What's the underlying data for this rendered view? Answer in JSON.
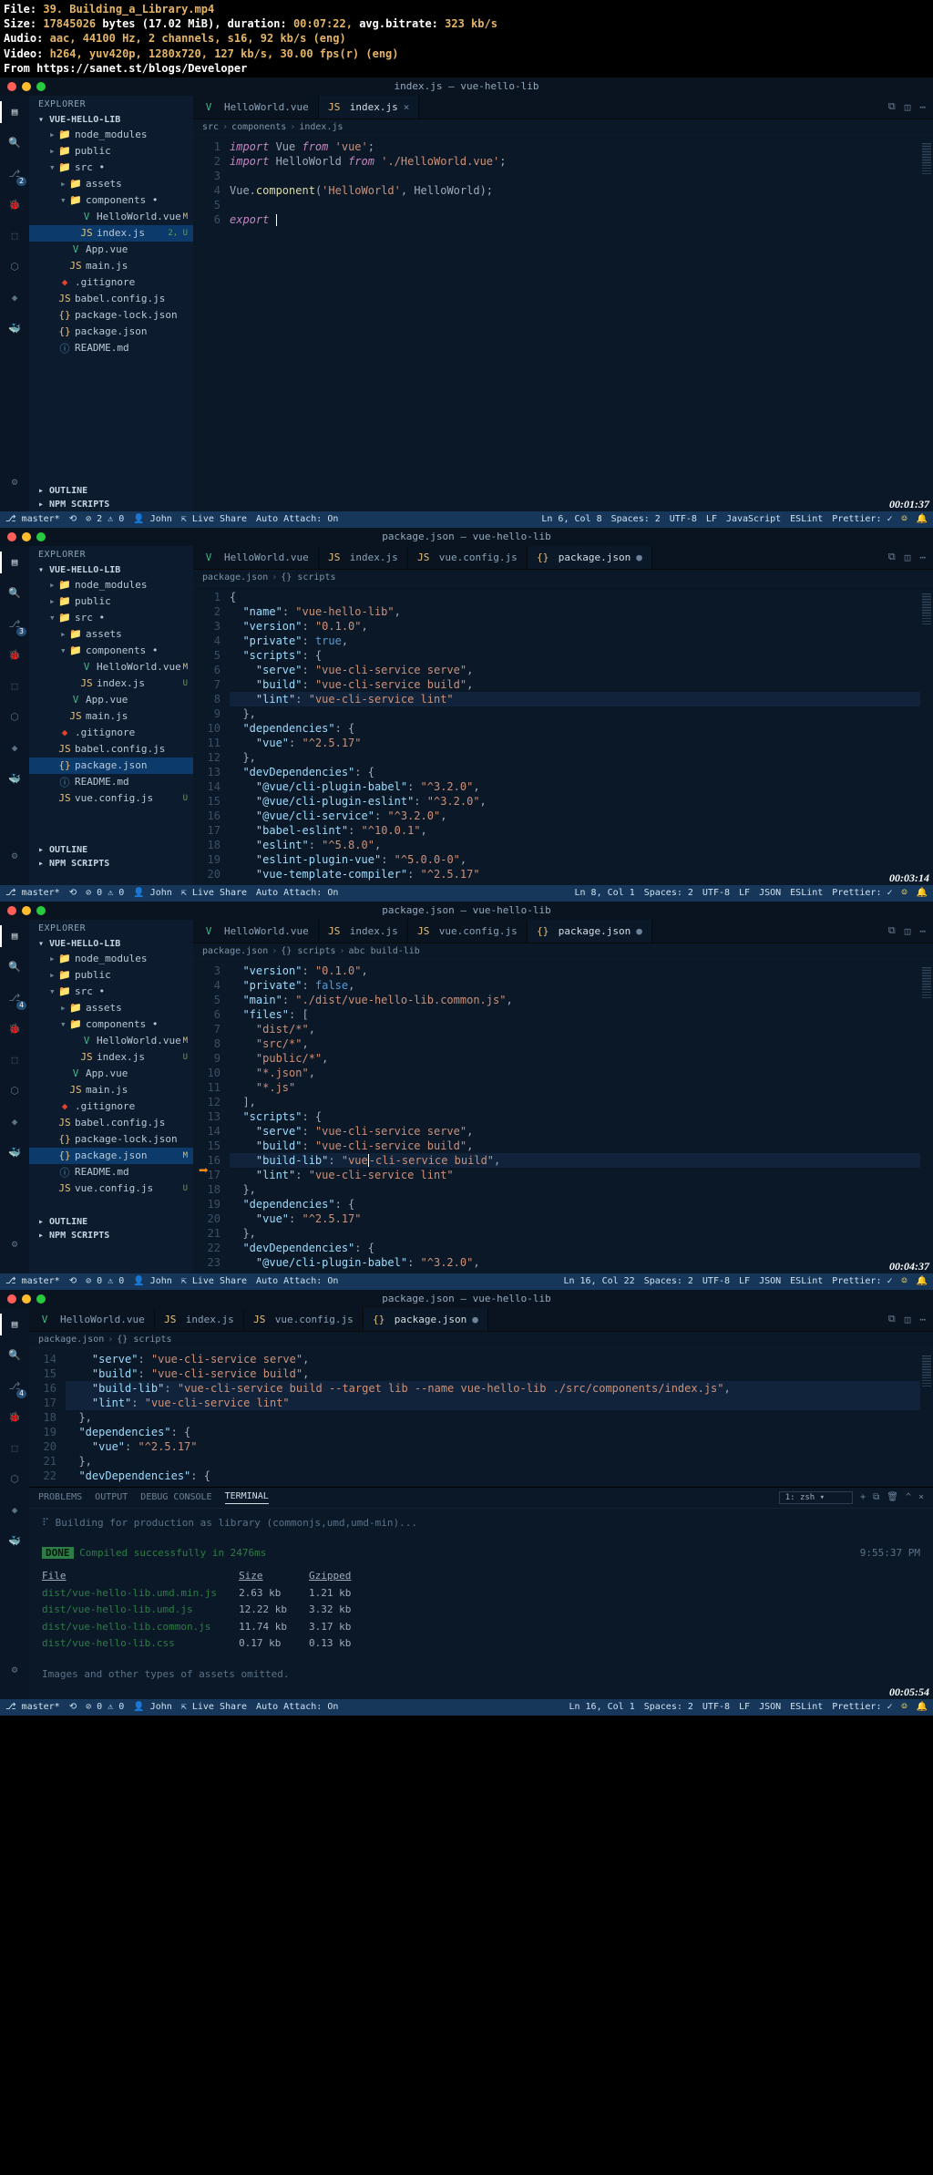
{
  "media_info": {
    "file_label": "File:",
    "file": "39. Building_a_Library.mp4",
    "size_label": "Size:",
    "size_bytes": "17845026",
    "size_mib": "bytes (17.02 MiB),",
    "dur_label": "duration:",
    "duration": "00:07:22,",
    "bitrate_label": "avg.bitrate:",
    "bitrate": "323 kb/s",
    "audio_label": "Audio:",
    "audio": "aac, 44100 Hz, 2 channels, s16, 92 kb/s (eng)",
    "video_label": "Video:",
    "video": "h264, yuv420p, 1280x720, 127 kb/s, 30.00 fps(r) (eng)",
    "from_label": "From",
    "from": "https://sanet.st/blogs/Developer"
  },
  "wins": [
    {
      "title": "index.js — vue-hello-lib",
      "activity_badge": "2",
      "sidebar_header": "EXPLORER",
      "project": "VUE-HELLO-LIB",
      "tree": [
        {
          "ind": 1,
          "icon": "folder",
          "name": "node_modules",
          "chev": "▸"
        },
        {
          "ind": 1,
          "icon": "folder",
          "name": "public",
          "chev": "▸"
        },
        {
          "ind": 1,
          "icon": "folder",
          "name": "src",
          "chev": "▾",
          "mod": true
        },
        {
          "ind": 2,
          "icon": "folder",
          "name": "assets",
          "chev": "▸"
        },
        {
          "ind": 2,
          "icon": "folder",
          "name": "components",
          "chev": "▾",
          "mod": true
        },
        {
          "ind": 3,
          "icon": "vue",
          "name": "HelloWorld.vue",
          "status": "M"
        },
        {
          "ind": 3,
          "icon": "js",
          "name": "index.js",
          "status": "2, U",
          "sel": true
        },
        {
          "ind": 2,
          "icon": "vue",
          "name": "App.vue"
        },
        {
          "ind": 2,
          "icon": "js",
          "name": "main.js"
        },
        {
          "ind": 1,
          "icon": "git",
          "name": ".gitignore"
        },
        {
          "ind": 1,
          "icon": "js",
          "name": "babel.config.js"
        },
        {
          "ind": 1,
          "icon": "json",
          "name": "package-lock.json"
        },
        {
          "ind": 1,
          "icon": "json",
          "name": "package.json"
        },
        {
          "ind": 1,
          "icon": "md",
          "name": "README.md"
        }
      ],
      "outline": "OUTLINE",
      "npm": "NPM SCRIPTS",
      "tabs": [
        {
          "icon": "vue",
          "label": "HelloWorld.vue"
        },
        {
          "icon": "js",
          "label": "index.js",
          "active": true
        }
      ],
      "crumbs": [
        "src",
        "components",
        "index.js"
      ],
      "code": {
        "start": 1,
        "lines": [
          "<span class='kw'>import</span> Vue <span class='kw'>from</span> <span class='str'>'vue'</span>;",
          "<span class='kw'>import</span> HelloWorld <span class='kw'>from</span> <span class='str'>'./HelloWorld.vue'</span>;",
          "",
          "Vue.<span class='fn'>component</span>(<span class='str'>'HelloWorld'</span>, HelloWorld);",
          "",
          "<span class='kw'>export</span> <span class='cursor'></span>"
        ]
      },
      "status": {
        "branch": "master*",
        "sync": "",
        "errs": "⊘ 2",
        "warns": "⚠ 0",
        "user": "John",
        "live": "Live Share",
        "auto": "Auto Attach: On",
        "pos": "Ln 6, Col 8",
        "spaces": "Spaces: 2",
        "enc": "UTF-8",
        "eol": "LF",
        "lang": "JavaScript",
        "eslint": "ESLint",
        "prettier": "Prettier: ✓"
      },
      "timecode": "00:01:37"
    },
    {
      "title": "package.json — vue-hello-lib",
      "activity_badge": "3",
      "sidebar_header": "EXPLORER",
      "project": "VUE-HELLO-LIB",
      "tree": [
        {
          "ind": 1,
          "icon": "folder",
          "name": "node_modules",
          "chev": "▸"
        },
        {
          "ind": 1,
          "icon": "folder",
          "name": "public",
          "chev": "▸"
        },
        {
          "ind": 1,
          "icon": "folder",
          "name": "src",
          "chev": "▾",
          "mod": true
        },
        {
          "ind": 2,
          "icon": "folder",
          "name": "assets",
          "chev": "▸"
        },
        {
          "ind": 2,
          "icon": "folder",
          "name": "components",
          "chev": "▾",
          "mod": true
        },
        {
          "ind": 3,
          "icon": "vue",
          "name": "HelloWorld.vue",
          "status": "M"
        },
        {
          "ind": 3,
          "icon": "js",
          "name": "index.js",
          "status": "U"
        },
        {
          "ind": 2,
          "icon": "vue",
          "name": "App.vue"
        },
        {
          "ind": 2,
          "icon": "js",
          "name": "main.js"
        },
        {
          "ind": 1,
          "icon": "git",
          "name": ".gitignore"
        },
        {
          "ind": 1,
          "icon": "js",
          "name": "babel.config.js"
        },
        {
          "ind": 1,
          "icon": "json",
          "name": "package.json",
          "sel": true
        },
        {
          "ind": 1,
          "icon": "md",
          "name": "README.md"
        },
        {
          "ind": 1,
          "icon": "js",
          "name": "vue.config.js",
          "status": "U"
        }
      ],
      "outline": "OUTLINE",
      "npm": "NPM SCRIPTS",
      "tabs": [
        {
          "icon": "vue",
          "label": "HelloWorld.vue"
        },
        {
          "icon": "js",
          "label": "index.js"
        },
        {
          "icon": "js",
          "label": "vue.config.js"
        },
        {
          "icon": "json",
          "label": "package.json",
          "active": true,
          "mod": true
        }
      ],
      "crumbs": [
        "package.json",
        "{} scripts"
      ],
      "code": {
        "start": 1,
        "lines": [
          "{",
          "  <span class='prop'>\"name\"</span>: <span class='str'>\"vue-hello-lib\"</span>,",
          "  <span class='prop'>\"version\"</span>: <span class='str'>\"0.1.0\"</span>,",
          "  <span class='prop'>\"private\"</span>: <span class='bool'>true</span>,",
          "  <span class='prop'>\"scripts\"</span>: {",
          "    <span class='prop'>\"serve\"</span>: <span class='str'>\"vue-cli-service serve\"</span>,",
          "    <span class='prop'>\"build\"</span>: <span class='str'>\"vue-cli-service build\"</span>,",
          "    <span class='prop'>\"lint\"</span>: <span class='str'>\"vue-cli-service lint\"</span>",
          "  },",
          "  <span class='prop'>\"dependencies\"</span>: {",
          "    <span class='prop'>\"vue\"</span>: <span class='str'>\"^2.5.17\"</span>",
          "  },",
          "  <span class='prop'>\"devDependencies\"</span>: {",
          "    <span class='prop'>\"@vue/cli-plugin-babel\"</span>: <span class='str'>\"^3.2.0\"</span>,",
          "    <span class='prop'>\"@vue/cli-plugin-eslint\"</span>: <span class='str'>\"^3.2.0\"</span>,",
          "    <span class='prop'>\"@vue/cli-service\"</span>: <span class='str'>\"^3.2.0\"</span>,",
          "    <span class='prop'>\"babel-eslint\"</span>: <span class='str'>\"^10.0.1\"</span>,",
          "    <span class='prop'>\"eslint\"</span>: <span class='str'>\"^5.8.0\"</span>,",
          "    <span class='prop'>\"eslint-plugin-vue\"</span>: <span class='str'>\"^5.0.0-0\"</span>,",
          "    <span class='prop'>\"vue-template-compiler\"</span>: <span class='str'>\"^2.5.17\"</span>"
        ],
        "highlight": 8
      },
      "status": {
        "branch": "master*",
        "errs": "⊘ 0",
        "warns": "⚠ 0",
        "user": "John",
        "live": "Live Share",
        "auto": "Auto Attach: On",
        "pos": "Ln 8, Col 1",
        "spaces": "Spaces: 2",
        "enc": "UTF-8",
        "eol": "LF",
        "lang": "JSON",
        "eslint": "ESLint",
        "prettier": "Prettier: ✓"
      },
      "timecode": "00:03:14"
    },
    {
      "title": "package.json — vue-hello-lib",
      "activity_badge": "4",
      "sidebar_header": "EXPLORER",
      "project": "VUE-HELLO-LIB",
      "tree": [
        {
          "ind": 1,
          "icon": "folder",
          "name": "node_modules",
          "chev": "▸"
        },
        {
          "ind": 1,
          "icon": "folder",
          "name": "public",
          "chev": "▸"
        },
        {
          "ind": 1,
          "icon": "folder",
          "name": "src",
          "chev": "▾",
          "mod": true
        },
        {
          "ind": 2,
          "icon": "folder",
          "name": "assets",
          "chev": "▸"
        },
        {
          "ind": 2,
          "icon": "folder",
          "name": "components",
          "chev": "▾",
          "mod": true
        },
        {
          "ind": 3,
          "icon": "vue",
          "name": "HelloWorld.vue",
          "status": "M"
        },
        {
          "ind": 3,
          "icon": "js",
          "name": "index.js",
          "status": "U"
        },
        {
          "ind": 2,
          "icon": "vue",
          "name": "App.vue"
        },
        {
          "ind": 2,
          "icon": "js",
          "name": "main.js"
        },
        {
          "ind": 1,
          "icon": "git",
          "name": ".gitignore"
        },
        {
          "ind": 1,
          "icon": "js",
          "name": "babel.config.js"
        },
        {
          "ind": 1,
          "icon": "json",
          "name": "package-lock.json"
        },
        {
          "ind": 1,
          "icon": "json",
          "name": "package.json",
          "status": "M",
          "sel": true
        },
        {
          "ind": 1,
          "icon": "md",
          "name": "README.md"
        },
        {
          "ind": 1,
          "icon": "js",
          "name": "vue.config.js",
          "status": "U"
        }
      ],
      "outline": "OUTLINE",
      "npm": "NPM SCRIPTS",
      "tabs": [
        {
          "icon": "vue",
          "label": "HelloWorld.vue"
        },
        {
          "icon": "js",
          "label": "index.js"
        },
        {
          "icon": "js",
          "label": "vue.config.js"
        },
        {
          "icon": "json",
          "label": "package.json",
          "active": true,
          "mod": true
        }
      ],
      "crumbs": [
        "package.json",
        "{} scripts",
        "abc build-lib"
      ],
      "arrow": true,
      "code": {
        "start": 3,
        "lines": [
          "  <span class='prop'>\"version\"</span>: <span class='str'>\"0.1.0\"</span>,",
          "  <span class='prop'>\"private\"</span>: <span class='bool'>false</span>,",
          "  <span class='prop'>\"main\"</span>: <span class='str'>\"./dist/vue-hello-lib.common.js\"</span>,",
          "  <span class='prop'>\"files\"</span>: [",
          "    <span class='str'>\"dist/*\"</span>,",
          "    <span class='str'>\"src/*\"</span>,",
          "    <span class='str'>\"public/*\"</span>,",
          "    <span class='str'>\"*.json\"</span>,",
          "    <span class='str'>\"*.js\"</span>",
          "  ],",
          "  <span class='prop'>\"scripts\"</span>: {",
          "    <span class='prop'>\"serve\"</span>: <span class='str'>\"vue-cli-service serve\"</span>,",
          "    <span class='prop'>\"build\"</span>: <span class='str'>\"vue-cli-service build\"</span>,",
          "    <span class='prop'>\"build-lib\"</span>: <span class='str'>\"vue<span style='border-left:1px solid #fff'></span>-cli-service build\"</span>,",
          "    <span class='prop'>\"lint\"</span>: <span class='str'>\"vue-cli-service lint\"</span>",
          "  },",
          "  <span class='prop'>\"dependencies\"</span>: {",
          "    <span class='prop'>\"vue\"</span>: <span class='str'>\"^2.5.17\"</span>",
          "  },",
          "  <span class='prop'>\"devDependencies\"</span>: {",
          "    <span class='prop'>\"@vue/cli-plugin-babel\"</span>: <span class='str'>\"^3.2.0\"</span>,"
        ],
        "highlight": 16
      },
      "status": {
        "branch": "master*",
        "errs": "⊘ 0",
        "warns": "⚠ 0",
        "user": "John",
        "live": "Live Share",
        "auto": "Auto Attach: On",
        "pos": "Ln 16, Col 22",
        "spaces": "Spaces: 2",
        "enc": "UTF-8",
        "eol": "LF",
        "lang": "JSON",
        "eslint": "ESLint",
        "prettier": "Prettier: ✓"
      },
      "timecode": "00:04:37"
    },
    {
      "title": "package.json — vue-hello-lib",
      "activity_badge": "4",
      "no_sidebar": true,
      "tabs": [
        {
          "icon": "vue",
          "label": "HelloWorld.vue"
        },
        {
          "icon": "js",
          "label": "index.js"
        },
        {
          "icon": "js",
          "label": "vue.config.js"
        },
        {
          "icon": "json",
          "label": "package.json",
          "active": true,
          "mod": true
        }
      ],
      "crumbs": [
        "package.json",
        "{} scripts"
      ],
      "code": {
        "start": 14,
        "lines": [
          "    <span class='prop'>\"serve\"</span>: <span class='str'>\"vue-cli-service serve\"</span>,",
          "    <span class='prop'>\"build\"</span>: <span class='str'>\"vue-cli-service build\"</span>,",
          "    <span class='prop'>\"build-lib\"</span>: <span class='str'>\"vue-cli-service build --target lib --name vue-hello-lib ./src/components/index.js\"</span>,",
          "    <span class='prop'>\"lint\"</span>: <span class='str'>\"vue-cli-service lint\"</span>",
          "  },",
          "  <span class='prop'>\"dependencies\"</span>: {",
          "    <span class='prop'>\"vue\"</span>: <span class='str'>\"^2.5.17\"</span>",
          "  },",
          "  <span class='prop'>\"devDependencies\"</span>: {"
        ],
        "highlight": 16,
        "highlight2": 17
      },
      "panel": {
        "tabs": [
          "PROBLEMS",
          "OUTPUT",
          "DEBUG CONSOLE",
          "TERMINAL"
        ],
        "active": 3,
        "shell": "1: zsh",
        "build_line": "Building for production as library (commonjs,umd,umd-min)...",
        "done": "DONE",
        "done_msg": " Compiled successfully in 2476ms",
        "time": "9:55:37 PM",
        "cols": [
          "File",
          "Size",
          "Gzipped"
        ],
        "rows": [
          [
            "dist/vue-hello-lib.umd.min.js",
            "2.63 kb",
            "1.21 kb"
          ],
          [
            "dist/vue-hello-lib.umd.js",
            "12.22 kb",
            "3.32 kb"
          ],
          [
            "dist/vue-hello-lib.common.js",
            "11.74 kb",
            "3.17 kb"
          ],
          [
            "dist/vue-hello-lib.css",
            "0.17 kb",
            "0.13 kb"
          ]
        ],
        "omitted": "Images and other types of assets omitted."
      },
      "status": {
        "branch": "master*",
        "errs": "⊘ 0",
        "warns": "⚠ 0",
        "user": "John",
        "live": "Live Share",
        "auto": "Auto Attach: On",
        "pos": "Ln 16, Col 1",
        "spaces": "Spaces: 2",
        "enc": "UTF-8",
        "eol": "LF",
        "lang": "JSON",
        "eslint": "ESLint",
        "prettier": "Prettier: ✓"
      },
      "timecode": "00:05:54"
    }
  ]
}
